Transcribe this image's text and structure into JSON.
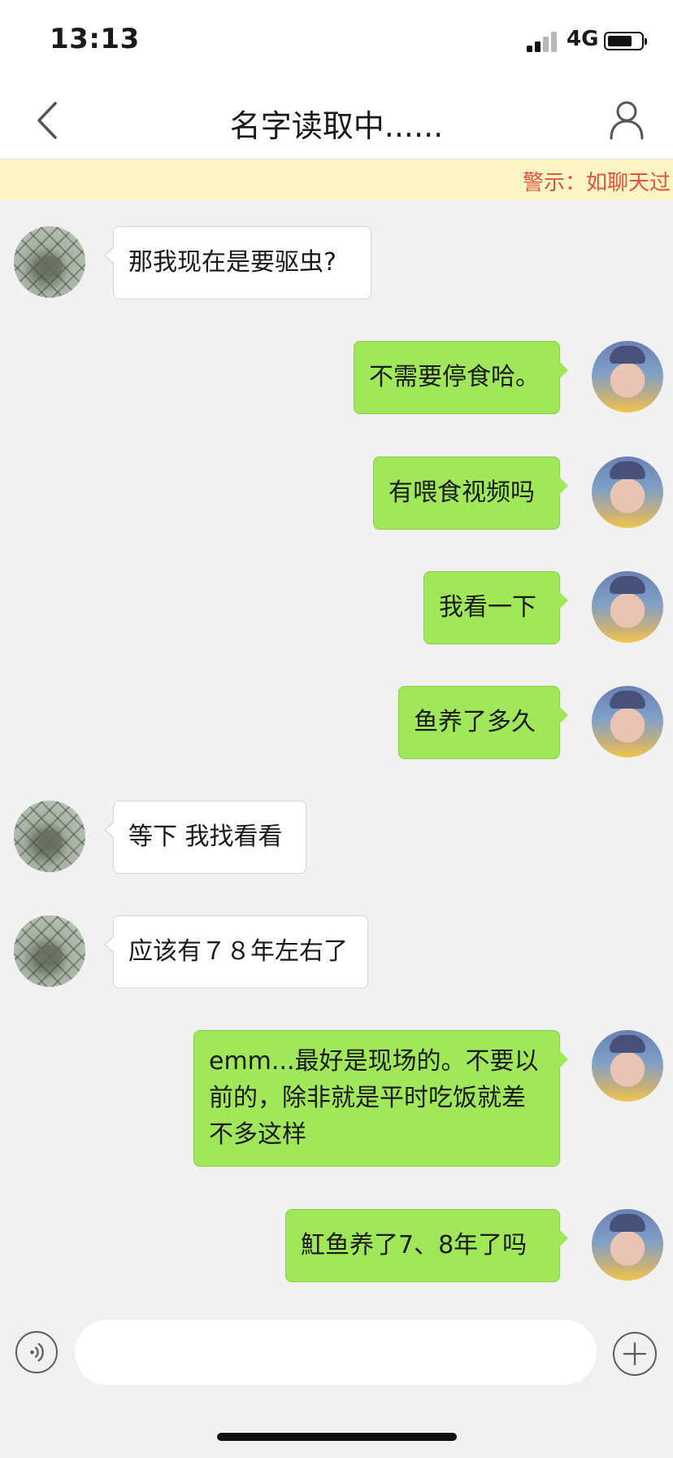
{
  "status_bar": {
    "time": "13:13",
    "network": "4G"
  },
  "nav": {
    "title": "名字读取中......",
    "back_icon": "chevron-left-icon",
    "profile_icon": "person-icon"
  },
  "warning": {
    "text": "警示：如聊天过"
  },
  "messages": [
    {
      "side": "them",
      "text": "那我现在是要驱虫?"
    },
    {
      "side": "me",
      "text": "不需要停食哈。"
    },
    {
      "side": "me",
      "text": "有喂食视频吗"
    },
    {
      "side": "me",
      "text": "我看一下"
    },
    {
      "side": "me",
      "text": "鱼养了多久"
    },
    {
      "side": "them",
      "text": "等下 我找看看"
    },
    {
      "side": "them",
      "text": "应该有７８年左右了"
    },
    {
      "side": "me",
      "lines": [
        "emm...最好是现场的。不要以",
        "前的，除非就是平时吃饭就差",
        "不多这样"
      ]
    },
    {
      "side": "me",
      "text": "魟鱼养了7、8年了吗"
    }
  ],
  "input_bar": {
    "voice_icon": "voice-icon",
    "input_value": "",
    "plus_icon": "plus-icon"
  },
  "colors": {
    "my_bubble": "#a0e75a",
    "their_bubble": "#ffffff",
    "background": "#f1f1f1",
    "warning_bg": "#fdf6c4",
    "warning_text": "#e0543f"
  }
}
